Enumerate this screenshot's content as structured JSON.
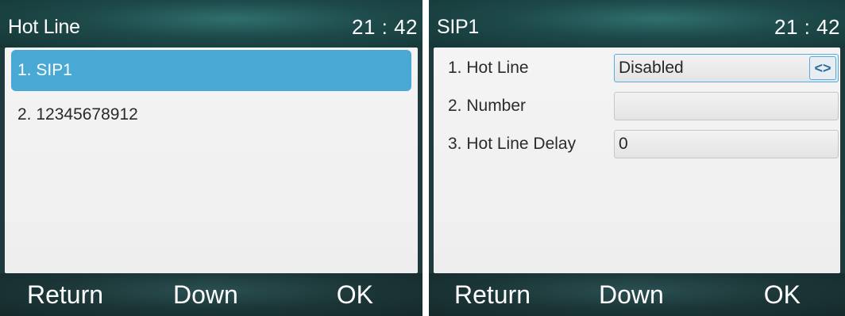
{
  "left_screen": {
    "title": "Hot Line",
    "clock": "21 : 42",
    "items": [
      {
        "label": "1. SIP1",
        "selected": true
      },
      {
        "label": "2. 12345678912",
        "selected": false
      }
    ],
    "softkeys": {
      "left": "Return",
      "middle": "Down",
      "right": "OK"
    }
  },
  "right_screen": {
    "title": "SIP1",
    "clock": "21 : 42",
    "fields": [
      {
        "label": "1. Hot Line",
        "value": "Disabled",
        "switch_icon": "left-right-arrows-icon"
      },
      {
        "label": "2. Number",
        "value": ""
      },
      {
        "label": "3. Hot Line Delay",
        "value": "0"
      }
    ],
    "softkeys": {
      "left": "Return",
      "middle": "Down",
      "right": "OK"
    }
  },
  "colors": {
    "selection": "#4aa9d4",
    "titlebar": "#1e4a4a",
    "content_bg": "#f0f0f0",
    "field_focus_border": "#55aee0"
  }
}
